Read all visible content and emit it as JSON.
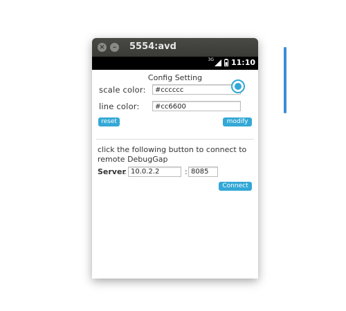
{
  "window": {
    "title": "5554:avd",
    "close_glyph": "×",
    "minimize_glyph": "–"
  },
  "statusbar": {
    "network": "3G",
    "time": "11:10",
    "icons": [
      "signal-icon",
      "battery-icon"
    ]
  },
  "config": {
    "title": "Config Setting",
    "scale_color_label": "scale color:",
    "scale_color_value": "#cccccc",
    "line_color_label": "line color:",
    "line_color_value": "#cc6600",
    "reset_label": "reset",
    "modify_label": "modify"
  },
  "debug": {
    "info": "click the following button to connect to remote DebugGap",
    "server_label": "Server",
    "colon": ":",
    "host_value": "10.0.2.2",
    "port_value": "8085",
    "connect_label": "Connect"
  },
  "colors": {
    "accent": "#33a8d6",
    "titlebar": "#3a3a36",
    "statusbar": "#000000"
  }
}
